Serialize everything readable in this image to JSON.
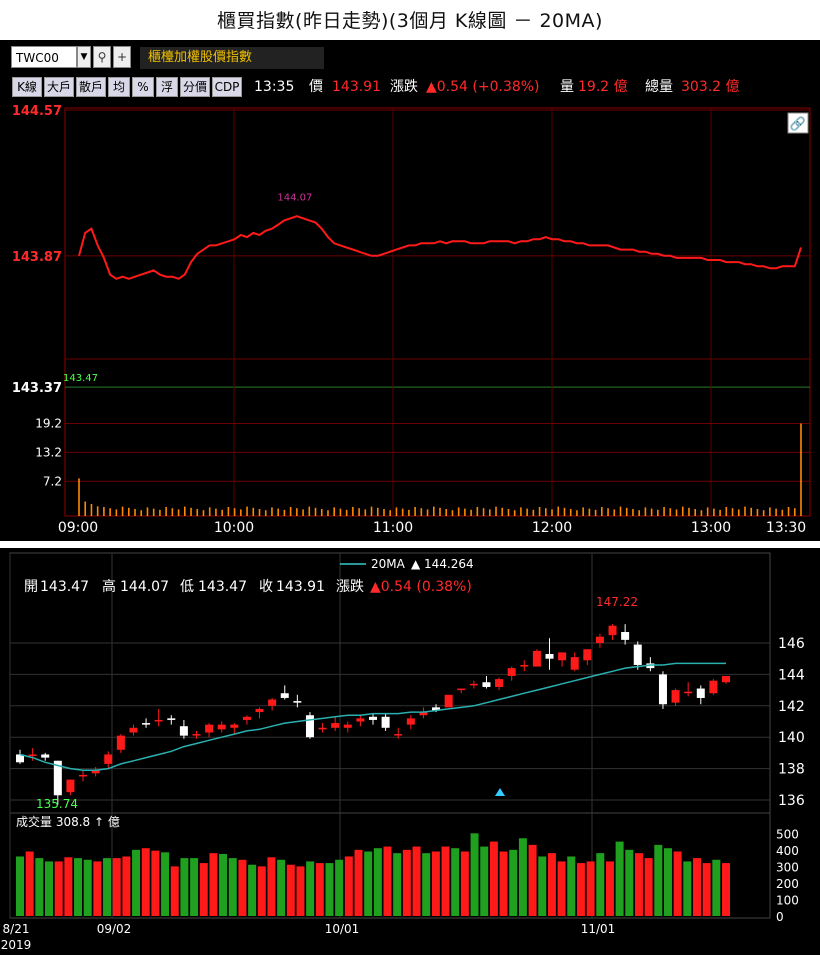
{
  "title": "櫃買指數(昨日走勢)(3個月 K線圖 － 20MA)",
  "toolbar": {
    "code": "TWC00",
    "name": "櫃檯加權股價指數",
    "buttons": [
      "K線",
      "大戶",
      "散戶",
      "均",
      "%",
      "浮",
      "分價",
      "CDP"
    ],
    "time": "13:35",
    "price_label": "價",
    "price": "143.91",
    "change_label": "漲跌",
    "change": "▲0.54 (+0.38%)",
    "vol_label": "量",
    "vol": "19.2 億",
    "total_label": "總量",
    "total": "303.2 億"
  },
  "intraday": {
    "y_labels": {
      "high": "144.57",
      "mid": "143.87",
      "ref": "143.37"
    },
    "prev_close_label": "143.47",
    "max_label": "144.07",
    "vol_labels": [
      "19.2",
      "13.2",
      "7.2"
    ],
    "x_labels": [
      "09:00",
      "10:00",
      "11:00",
      "12:00",
      "13:00",
      "13:30"
    ]
  },
  "kline": {
    "legend_name": "20MA",
    "legend_value": "▲ 144.264",
    "ohlc": {
      "open_label": "開",
      "open": "143.47",
      "high_label": "高",
      "high": "144.07",
      "low_label": "低",
      "low": "143.47",
      "close_label": "收",
      "close": "143.91",
      "change_label": "漲跌",
      "change": "▲0.54 (0.38%)"
    },
    "high_mark": "147.22",
    "low_mark": "135.74",
    "y_ticks": [
      "146",
      "144",
      "142",
      "140",
      "138",
      "136"
    ],
    "vol_label": "成交量 308.8 ↑ 億",
    "vol_ticks": [
      "500",
      "400",
      "300",
      "200",
      "100",
      "0"
    ],
    "x_labels": [
      "8/21",
      "09/02",
      "10/01",
      "11/01"
    ],
    "year": "2019"
  },
  "chart_data": [
    {
      "type": "line",
      "title": "",
      "x_range": [
        "09:00",
        "13:30"
      ],
      "ylim": [
        143.37,
        144.57
      ],
      "prev_close": 143.47,
      "series": [
        {
          "name": "",
          "values": [
            143.87,
            143.98,
            144.0,
            143.92,
            143.86,
            143.78,
            143.76,
            143.77,
            143.76,
            143.77,
            143.78,
            143.79,
            143.8,
            143.78,
            143.77,
            143.77,
            143.76,
            143.78,
            143.84,
            143.88,
            143.9,
            143.92,
            143.92,
            143.93,
            143.94,
            143.95,
            143.97,
            143.96,
            143.98,
            143.97,
            143.99,
            144.0,
            144.02,
            144.04,
            144.05,
            144.06,
            144.05,
            144.04,
            144.03,
            144.0,
            143.96,
            143.93,
            143.92,
            143.91,
            143.9,
            143.89,
            143.88,
            143.87,
            143.87,
            143.88,
            143.89,
            143.9,
            143.91,
            143.92,
            143.92,
            143.93,
            143.93,
            143.93,
            143.94,
            143.93,
            143.94,
            143.94,
            143.94,
            143.93,
            143.93,
            143.93,
            143.94,
            143.94,
            143.94,
            143.94,
            143.93,
            143.94,
            143.94,
            143.95,
            143.95,
            143.96,
            143.95,
            143.95,
            143.94,
            143.94,
            143.93,
            143.93,
            143.92,
            143.92,
            143.92,
            143.92,
            143.91,
            143.9,
            143.9,
            143.9,
            143.89,
            143.89,
            143.88,
            143.88,
            143.87,
            143.87,
            143.86,
            143.86,
            143.86,
            143.86,
            143.86,
            143.85,
            143.85,
            143.85,
            143.84,
            143.84,
            143.84,
            143.83,
            143.83,
            143.82,
            143.82,
            143.81,
            143.81,
            143.82,
            143.82,
            143.82,
            143.91
          ]
        }
      ],
      "volume": {
        "ylim": [
          0,
          22
        ],
        "peak_last": 19.2,
        "typical": 1.5
      }
    },
    {
      "type": "candlestick",
      "title": "",
      "ma_name": "20MA",
      "ylim": [
        135,
        147.5
      ],
      "categories_labels": [
        "8/21",
        "09/02",
        "10/01",
        "11/01"
      ],
      "candles": [
        [
          138.9,
          139.2,
          138.3,
          138.4
        ],
        [
          138.9,
          139.3,
          138.5,
          138.9
        ],
        [
          138.9,
          139.0,
          138.5,
          138.7
        ],
        [
          138.5,
          138.5,
          135.7,
          136.3
        ],
        [
          136.5,
          137.3,
          136.3,
          137.3
        ],
        [
          137.5,
          137.9,
          137.2,
          137.6
        ],
        [
          137.7,
          138.1,
          137.5,
          137.9
        ],
        [
          138.3,
          139.1,
          138.0,
          138.9
        ],
        [
          139.2,
          140.2,
          139.0,
          140.1
        ],
        [
          140.3,
          140.8,
          140.1,
          140.6
        ],
        [
          140.9,
          141.2,
          140.6,
          140.8
        ],
        [
          141.0,
          141.8,
          140.7,
          141.1
        ],
        [
          141.2,
          141.4,
          140.8,
          141.1
        ],
        [
          140.7,
          141.1,
          139.9,
          140.1
        ],
        [
          140.2,
          140.4,
          139.9,
          140.2
        ],
        [
          140.3,
          140.9,
          140.0,
          140.8
        ],
        [
          140.5,
          141.0,
          140.3,
          140.8
        ],
        [
          140.6,
          140.9,
          140.2,
          140.8
        ],
        [
          141.1,
          141.4,
          140.8,
          141.3
        ],
        [
          141.6,
          141.9,
          141.2,
          141.8
        ],
        [
          142.0,
          142.5,
          141.7,
          142.4
        ],
        [
          142.8,
          143.3,
          142.4,
          142.5
        ],
        [
          142.3,
          142.7,
          141.9,
          142.2
        ],
        [
          141.4,
          141.6,
          139.9,
          140.0
        ],
        [
          140.5,
          140.9,
          140.3,
          140.6
        ],
        [
          140.6,
          141.3,
          140.4,
          140.9
        ],
        [
          140.6,
          141.0,
          140.3,
          140.8
        ],
        [
          141.0,
          141.4,
          140.7,
          141.2
        ],
        [
          141.3,
          141.5,
          140.8,
          141.1
        ],
        [
          141.3,
          141.5,
          140.4,
          140.6
        ],
        [
          140.2,
          140.6,
          139.9,
          140.2
        ],
        [
          140.8,
          141.4,
          140.5,
          141.2
        ],
        [
          141.4,
          141.9,
          141.2,
          141.6
        ],
        [
          141.9,
          142.1,
          141.6,
          141.7
        ],
        [
          141.9,
          142.7,
          141.9,
          142.7
        ],
        [
          143.0,
          143.1,
          142.8,
          143.1
        ],
        [
          143.3,
          143.6,
          143.1,
          143.4
        ],
        [
          143.5,
          143.9,
          143.1,
          143.2
        ],
        [
          143.2,
          143.8,
          143.0,
          143.7
        ],
        [
          143.9,
          144.5,
          143.6,
          144.4
        ],
        [
          144.5,
          144.9,
          144.2,
          144.6
        ],
        [
          144.5,
          145.6,
          144.5,
          145.5
        ],
        [
          145.3,
          146.3,
          144.3,
          145.0
        ],
        [
          144.9,
          145.4,
          144.5,
          145.4
        ],
        [
          144.3,
          145.4,
          144.2,
          145.1
        ],
        [
          144.9,
          145.6,
          144.6,
          145.6
        ],
        [
          146.0,
          146.6,
          145.7,
          146.4
        ],
        [
          146.5,
          147.2,
          146.2,
          147.1
        ],
        [
          146.7,
          147.2,
          145.9,
          146.2
        ],
        [
          145.9,
          146.1,
          144.3,
          144.6
        ],
        [
          144.7,
          145.1,
          144.2,
          144.4
        ],
        [
          144.0,
          144.2,
          141.8,
          142.1
        ],
        [
          142.2,
          143.1,
          142.0,
          143.0
        ],
        [
          142.8,
          143.5,
          142.6,
          142.9
        ],
        [
          143.1,
          143.3,
          142.1,
          142.5
        ],
        [
          142.8,
          143.7,
          142.7,
          143.6
        ],
        [
          143.5,
          143.9,
          143.4,
          143.9
        ]
      ],
      "ma20": [
        138.9,
        138.7,
        138.4,
        138.2,
        138.0,
        137.9,
        137.9,
        138.0,
        138.3,
        138.5,
        138.7,
        138.9,
        139.1,
        139.4,
        139.6,
        139.8,
        140.0,
        140.2,
        140.4,
        140.5,
        140.7,
        140.9,
        141.0,
        141.1,
        141.2,
        141.3,
        141.4,
        141.4,
        141.5,
        141.5,
        141.5,
        141.6,
        141.6,
        141.7,
        141.8,
        141.9,
        142.0,
        142.2,
        142.4,
        142.6,
        142.8,
        143.0,
        143.2,
        143.4,
        143.6,
        143.8,
        144.0,
        144.2,
        144.4,
        144.5,
        144.6,
        144.6,
        144.7,
        144.7,
        144.7,
        144.7,
        144.7
      ],
      "volume": [
        360,
        390,
        350,
        330,
        330,
        355,
        350,
        340,
        330,
        350,
        350,
        360,
        400,
        410,
        395,
        385,
        300,
        350,
        350,
        320,
        380,
        375,
        350,
        340,
        310,
        300,
        355,
        340,
        310,
        300,
        330,
        320,
        320,
        340,
        360,
        400,
        390,
        410,
        420,
        380,
        400,
        420,
        380,
        390,
        420,
        410,
        390,
        500,
        420,
        450,
        390,
        400,
        470,
        430,
        360,
        380,
        330,
        360,
        320,
        330,
        380,
        330,
        450,
        400,
        380,
        350,
        430,
        410,
        390,
        330,
        350,
        320,
        340,
        320
      ],
      "vol_ylim": [
        0,
        520
      ]
    }
  ]
}
